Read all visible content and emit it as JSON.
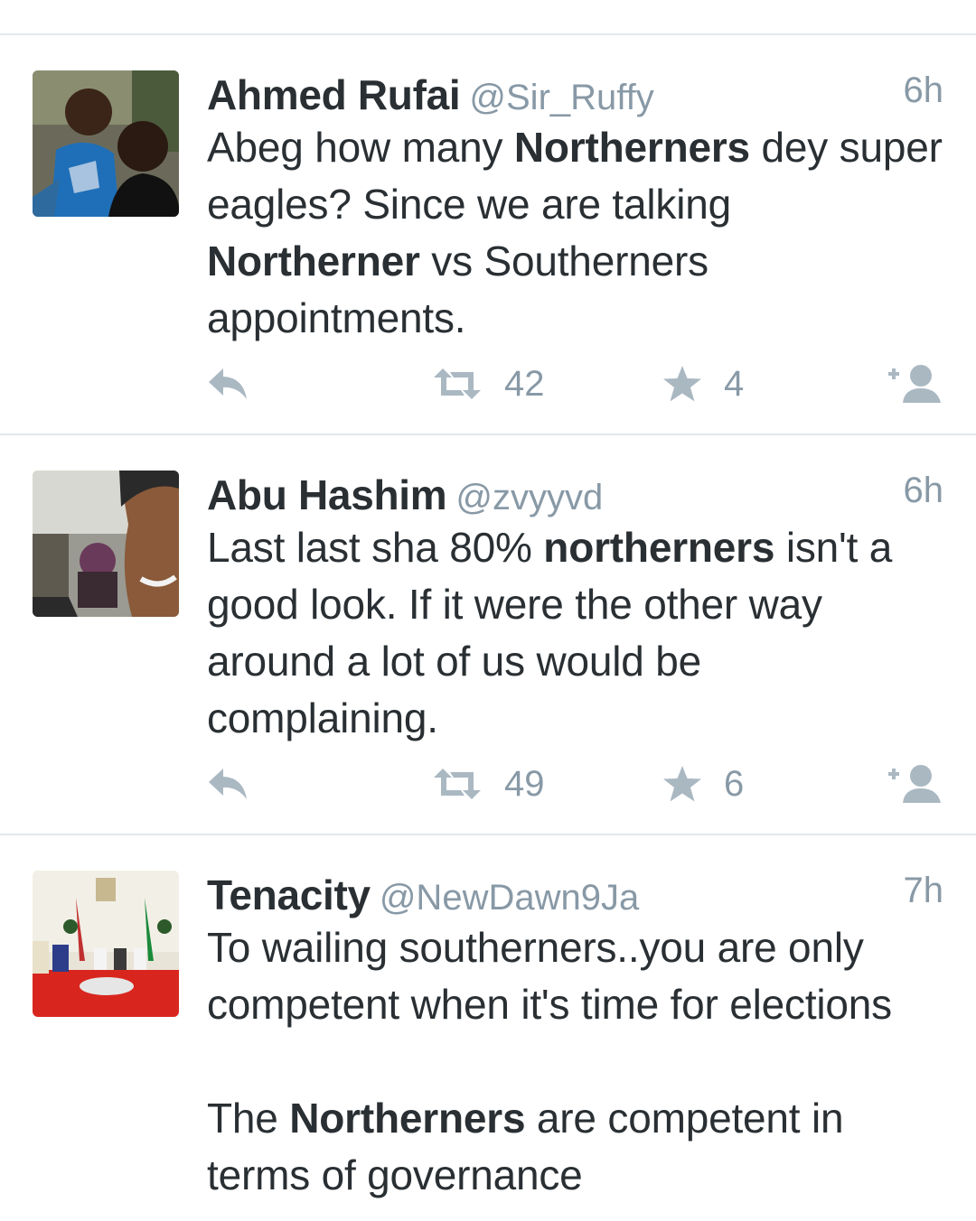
{
  "tweets": [
    {
      "name": "Ahmed Rufai",
      "handle": "@Sir_Ruffy",
      "time": "6h",
      "text": [
        {
          "t": "Abeg how many ",
          "b": false
        },
        {
          "t": "Northerners",
          "b": true
        },
        {
          "t": " dey super eagles? Since we are talking ",
          "b": false
        },
        {
          "t": "Northerner",
          "b": true
        },
        {
          "t": " vs Southerners appointments.",
          "b": false
        }
      ],
      "retweets": "42",
      "favorites": "4"
    },
    {
      "name": "Abu Hashim",
      "handle": "@zvyyvd",
      "time": "6h",
      "text": [
        {
          "t": "Last last sha 80% ",
          "b": false
        },
        {
          "t": "northerners",
          "b": true
        },
        {
          "t": " isn't a good look. If it were the other way around a lot of us would be complaining.",
          "b": false
        }
      ],
      "retweets": "49",
      "favorites": "6"
    },
    {
      "name": "Tenacity",
      "handle": "@NewDawn9Ja",
      "time": "7h",
      "text_p1": "To wailing southerners..you are only competent when it's time for elections",
      "text_p2": [
        {
          "t": "The ",
          "b": false
        },
        {
          "t": "Northerners",
          "b": true
        },
        {
          "t": " are competent in terms of governance",
          "b": false
        }
      ]
    }
  ],
  "icons": {
    "reply": "reply-icon",
    "retweet": "retweet-icon",
    "favorite": "star-icon",
    "follow": "follow-icon"
  },
  "colors": {
    "icon": "#aab8c2",
    "meta": "#8899a6",
    "text": "#292f33",
    "divider": "#e1e8ed"
  }
}
